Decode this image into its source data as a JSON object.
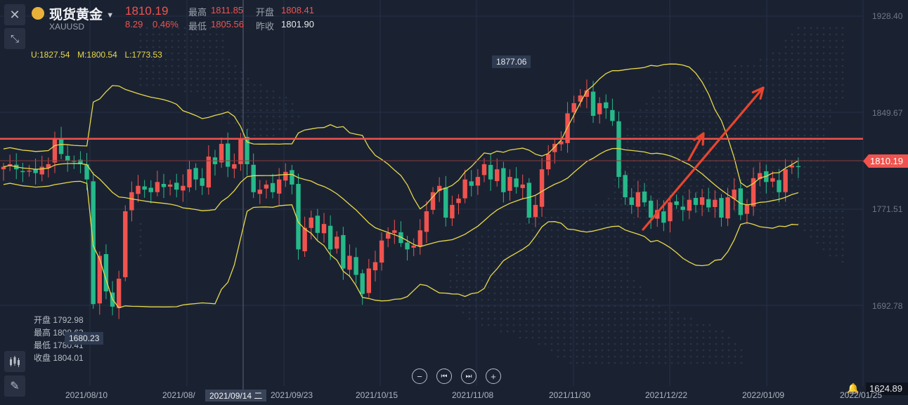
{
  "header": {
    "title": "现货黄金",
    "symbol": "XAUUSD",
    "price": "1810.19",
    "change": "8.29",
    "change_pct": "0.46%",
    "high_label": "最高",
    "high": "1811.85",
    "open_label": "开盘",
    "open": "1808.41",
    "low_label": "最低",
    "low": "1805.56",
    "prev_close_label": "昨收",
    "prev_close": "1801.90"
  },
  "boll_legend": {
    "u": "U:1827.54",
    "m": "M:1800.54",
    "l": "L:1773.53"
  },
  "ohlc_panel": {
    "open": "开盘 1792.98",
    "high": "最高 1808.63",
    "low": "最低 1780.41",
    "close": "收盘 1804.01"
  },
  "markers": {
    "max": "1877.06",
    "min": "1680.23",
    "current": "1810.19",
    "bottom": "1624.89",
    "crosshair_date": "2021/09/14 二"
  },
  "colors": {
    "up": "#f0534e",
    "down": "#26b98a",
    "boll": "#e8d84a",
    "resistance": "#f0534e",
    "arrow": "#e8452e",
    "bg": "#1a2232"
  },
  "icons": {
    "close": "close-icon",
    "collapse": "collapse-icon",
    "indicator": "candles-icon",
    "draw": "pencil-icon",
    "alert": "bell-icon"
  },
  "chart_data": {
    "type": "candlestick",
    "y_ticks": [
      "1928.40",
      "1849.67",
      "1771.51",
      "1692.78"
    ],
    "x_ticks": [
      "2021/08/10",
      "2021/08/",
      "2021/09/23",
      "2021/10/15",
      "2021/11/08",
      "2021/11/30",
      "2021/12/22",
      "2022/01/09",
      "2022/01/25"
    ],
    "ylim": [
      1624.89,
      1928.4
    ],
    "resistance_level": 1832,
    "series_close": [
      1810,
      1812,
      1808,
      1806,
      1807,
      1805,
      1810,
      1812,
      1832,
      1820,
      1815,
      1814,
      1812,
      1800,
      1702,
      1740,
      1712,
      1700,
      1722,
      1775,
      1790,
      1795,
      1792,
      1790,
      1798,
      1794,
      1796,
      1792,
      1795,
      1808,
      1800,
      1795,
      1818,
      1812,
      1828,
      1810,
      1812,
      1832,
      1812,
      1790,
      1792,
      1796,
      1790,
      1800,
      1806,
      1796,
      1745,
      1762,
      1770,
      1758,
      1765,
      1745,
      1755,
      1730,
      1740,
      1725,
      1710,
      1730,
      1735,
      1752,
      1758,
      1760,
      1750,
      1745,
      1748,
      1760,
      1775,
      1790,
      1795,
      1770,
      1780,
      1785,
      1800,
      1795,
      1802,
      1812,
      1800,
      1808,
      1790,
      1802,
      1794,
      1796,
      1770,
      1780,
      1808,
      1820,
      1828,
      1830,
      1852,
      1860,
      1866,
      1870,
      1850,
      1860,
      1856,
      1846,
      1802,
      1786,
      1780,
      1790,
      1782,
      1770,
      1776,
      1766,
      1782,
      1780,
      1776,
      1784,
      1780,
      1786,
      1778,
      1784,
      1770,
      1786,
      1792,
      1772,
      1780,
      1801,
      1805,
      1798,
      1801,
      1790,
      1808,
      1811,
      1810
    ]
  }
}
